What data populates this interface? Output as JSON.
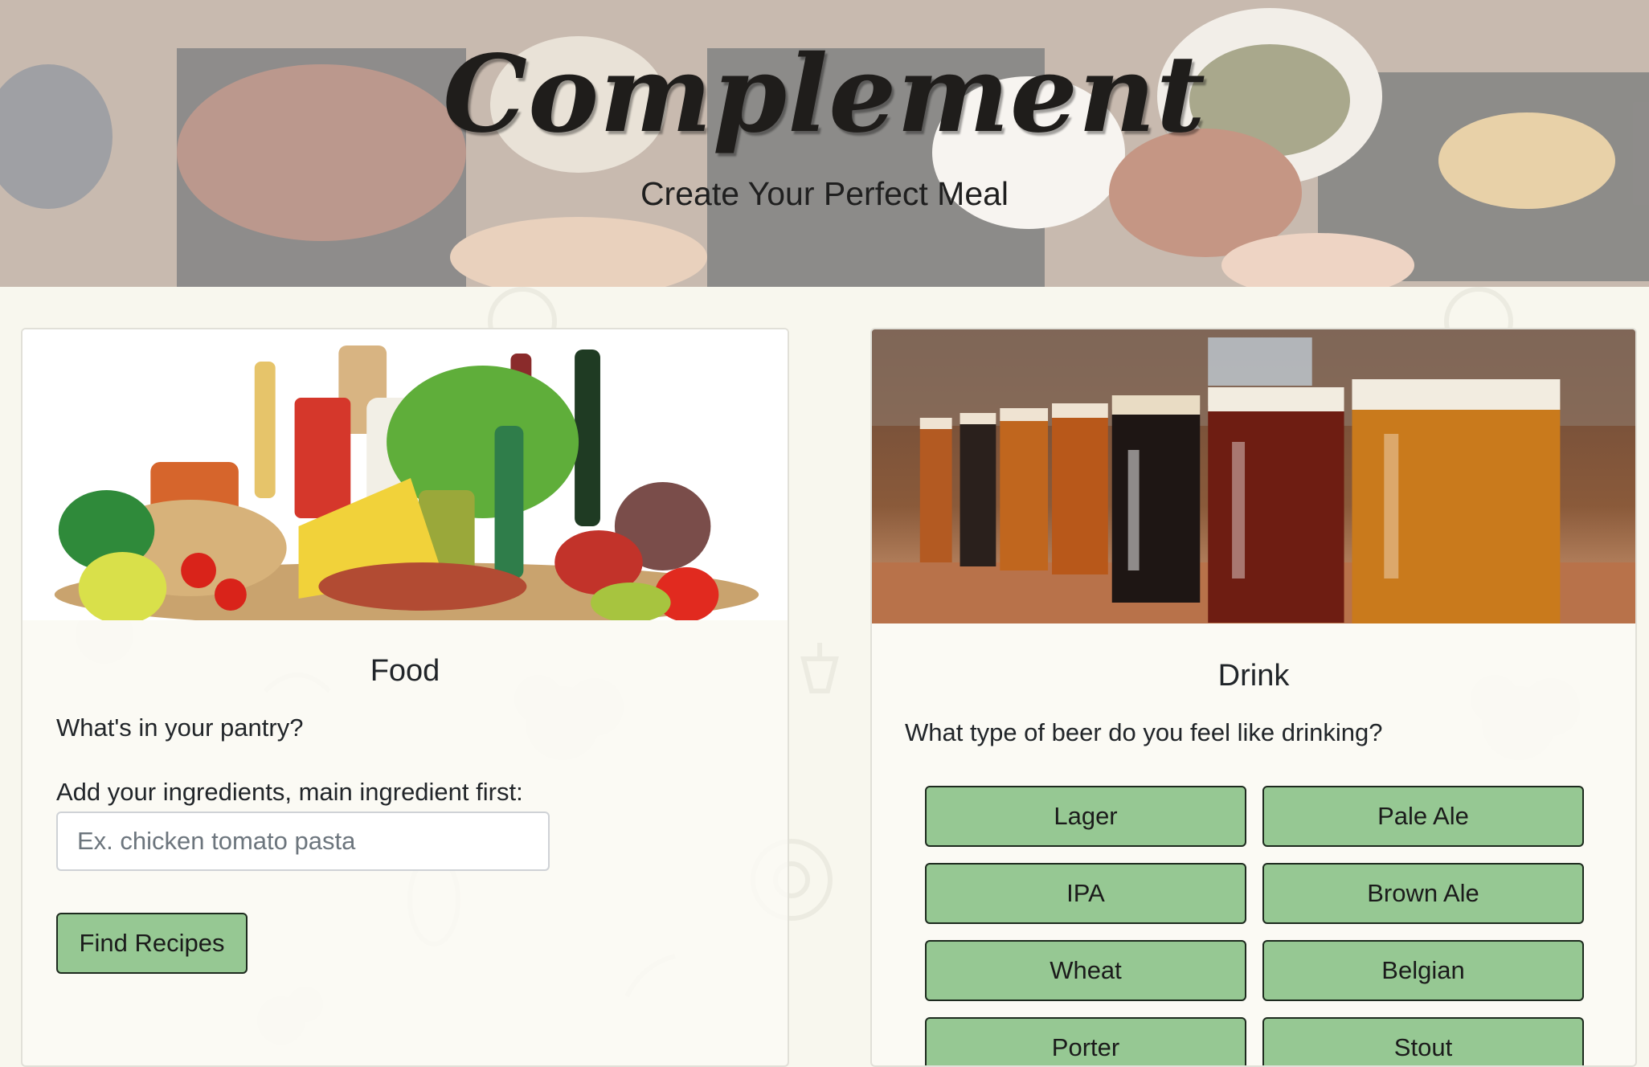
{
  "header": {
    "brand": "Complement",
    "tagline": "Create Your Perfect Meal"
  },
  "food_card": {
    "title": "Food",
    "question": "What's in your pantry?",
    "ingredients_label": "Add your ingredients, main ingredient first:",
    "ingredients_placeholder": "Ex. chicken tomato pasta",
    "ingredients_value": "",
    "submit_label": "Find Recipes"
  },
  "drink_card": {
    "title": "Drink",
    "question": "What type of beer do you feel like drinking?",
    "beer_types": [
      "Lager",
      "Pale Ale",
      "IPA",
      "Brown Ale",
      "Wheat",
      "Belgian",
      "Porter",
      "Stout"
    ]
  },
  "colors": {
    "page_background": "#f8f7ee",
    "button_green": "#96c893",
    "button_border": "#1d2a1e",
    "card_background": "#fbfaf4"
  }
}
